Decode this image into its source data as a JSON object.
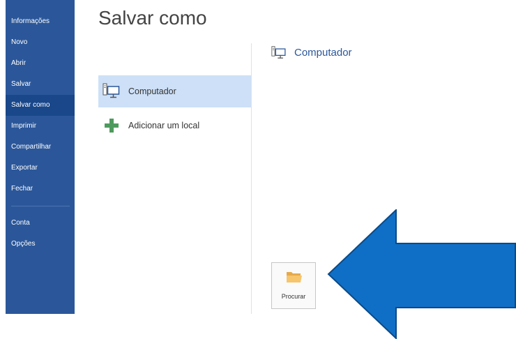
{
  "nav": {
    "items": [
      {
        "label": "Informações"
      },
      {
        "label": "Novo"
      },
      {
        "label": "Abrir"
      },
      {
        "label": "Salvar"
      },
      {
        "label": "Salvar como",
        "selected": true
      },
      {
        "label": "Imprimir"
      },
      {
        "label": "Compartilhar"
      },
      {
        "label": "Exportar"
      },
      {
        "label": "Fechar"
      },
      {
        "label": "Conta"
      },
      {
        "label": "Opções"
      }
    ]
  },
  "page_title": "Salvar como",
  "places": [
    {
      "label": "Computador",
      "icon": "computer-icon",
      "selected": true
    },
    {
      "label": "Adicionar um local",
      "icon": "plus-icon",
      "selected": false
    }
  ],
  "right_panel": {
    "heading": "Computador",
    "heading_icon": "computer-icon",
    "browse_label": "Procurar",
    "browse_icon": "folder-icon"
  },
  "colors": {
    "nav_bg": "#2b579a",
    "nav_selected": "#19478a",
    "place_selected": "#cde0f7",
    "accent": "#2b579a",
    "arrow_fill": "#0f6fc6",
    "arrow_stroke": "#0b4a86",
    "plus_green": "#4e9a5e"
  }
}
